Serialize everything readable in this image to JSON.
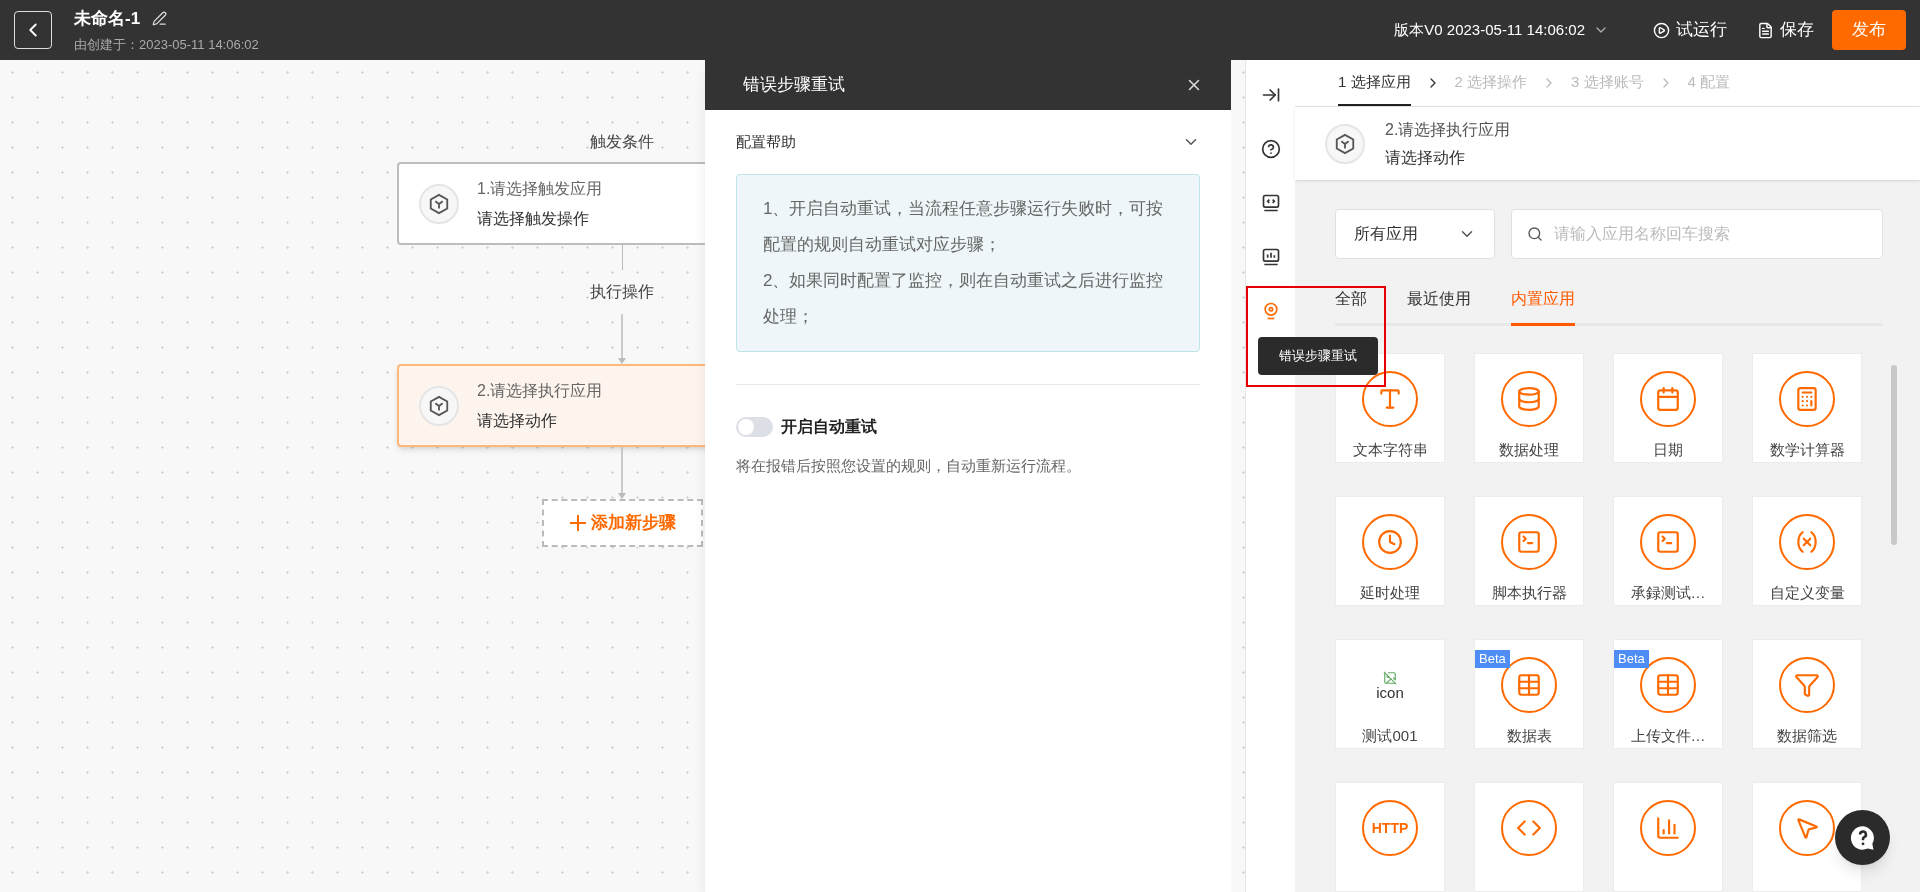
{
  "header": {
    "title": "未命名-1",
    "subtitle": "由创建于：2023-05-11 14:06:02",
    "version": "版本V0 2023-05-11 14:06:02",
    "actions": [
      {
        "kind": "run",
        "label": "试运行"
      },
      {
        "kind": "save",
        "label": "保存"
      },
      {
        "kind": "publish",
        "label": "发布"
      }
    ]
  },
  "canvas": {
    "trigger_label": "触发条件",
    "nodes": [
      {
        "title": "1.请选择触发应用",
        "subtitle": "请选择触发操作",
        "selected": false
      },
      {
        "title": "2.请选择执行应用",
        "subtitle": "请选择动作",
        "selected": true
      }
    ],
    "action_label": "执行操作",
    "add_step": "添加新步骤"
  },
  "panel": {
    "title": "错误步骤重试",
    "help_title": "配置帮助",
    "help_expanded": true,
    "help_lines": [
      "1、开启自动重试，当流程任意步骤运行失败时，可按配置的规则自动重试对应步骤；",
      "2、如果同时配置了监控，则在自动重试之后进行监控处理；"
    ],
    "toggle": {
      "label": "开启自动重试",
      "on": false
    },
    "description": "将在报错后按照您设置的规则，自动重新运行流程。"
  },
  "toolbar": {
    "tooltip": "错误步骤重试",
    "items": [
      {
        "selected": false
      },
      {
        "selected": false
      },
      {
        "selected": false
      },
      {
        "selected": false
      },
      {
        "selected": true
      }
    ]
  },
  "wizard": {
    "steps": [
      {
        "label": "1 选择应用",
        "selected": true
      },
      {
        "label": "2 选择操作",
        "selected": false
      },
      {
        "label": "3 选择账号",
        "selected": false
      },
      {
        "label": "4 配置",
        "selected": false
      }
    ],
    "current": {
      "title": "2.请选择执行应用",
      "subtitle": "请选择动作"
    },
    "filter": {
      "value": "所有应用"
    },
    "search": {
      "placeholder": "请输入应用名称回车搜索"
    },
    "tabs": [
      {
        "label": "全部",
        "selected": false
      },
      {
        "label": "最近使用",
        "selected": false
      },
      {
        "label": "内置应用",
        "selected": true
      }
    ],
    "apps": [
      {
        "name": "文本字符串"
      },
      {
        "name": "数据处理"
      },
      {
        "name": "日期"
      },
      {
        "name": "数学计算器"
      },
      {
        "name": "延时处理"
      },
      {
        "name": "脚本执行器"
      },
      {
        "name": "承録测试…"
      },
      {
        "name": "自定义变量"
      },
      {
        "name": "测试001",
        "kind": "broken",
        "alt": "icon"
      },
      {
        "name": "数据表",
        "badge": "Beta"
      },
      {
        "name": "上传文件…",
        "badge": "Beta"
      },
      {
        "name": "数据筛选"
      },
      {
        "kind": "http",
        "icon_text": "HTTP"
      },
      {
        "kind": "icon"
      },
      {
        "kind": "icon"
      },
      {
        "kind": "icon"
      }
    ]
  }
}
